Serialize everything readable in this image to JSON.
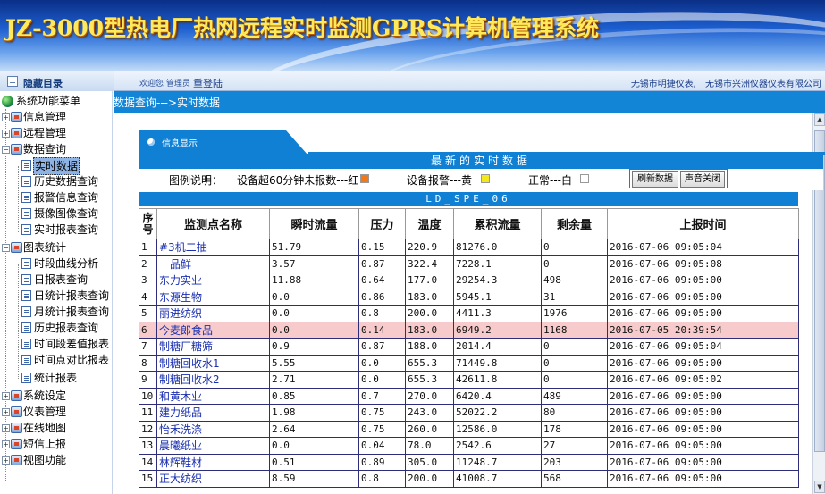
{
  "header": {
    "title": "JZ-3000型热电厂热网远程实时监测GPRS计算机管理系统"
  },
  "topbar": {
    "panel_title": "隐藏目录",
    "welcome": "欢迎您 管理员",
    "relogin": "重登陆",
    "company": "无锡市明捷仪表厂 无锡市兴洲仪器仪表有限公司"
  },
  "sidebar": {
    "root": "系统功能菜单",
    "items": [
      "信息管理",
      "远程管理",
      "数据查询",
      "实时数据",
      "历史数据查询",
      "报警信息查询",
      "摄像图像查询",
      "实时报表查询",
      "图表统计",
      "时段曲线分析",
      "日报表查询",
      "日统计报表查询",
      "月统计报表查询",
      "历史报表查询",
      "时间段差值报表",
      "时间点对比报表",
      "统计报表",
      "系统设定",
      "仪表管理",
      "在线地图",
      "短信上报",
      "视图功能"
    ]
  },
  "breadcrumb": "数据查询--->实时数据",
  "tab": {
    "label": "信息显示"
  },
  "heading": "最新的实时数据",
  "legend": {
    "label": "图例说明：",
    "red": "设备超60分钟未报数---红",
    "yellow": "设备报警---黄",
    "white": "正常---白",
    "btn_refresh": "刷新数据",
    "btn_sound": "声音关闭"
  },
  "colors": {
    "red": "#f07a1a",
    "yellow": "#f2e81c",
    "white": "#ffffff",
    "alert_row": "#f7cbcb",
    "accent": "#0f80d4"
  },
  "station": "LD_SPE_06",
  "table": {
    "headers": [
      "序号",
      "监测点名称",
      "瞬时流量",
      "压力",
      "温度",
      "累积流量",
      "剩余量",
      "上报时间"
    ],
    "rows": [
      [
        "1",
        "#3机二抽",
        "51.79",
        "0.15",
        "220.9",
        "81276.0",
        "0",
        "2016-07-06 09:05:04"
      ],
      [
        "2",
        "一品鲜",
        "3.57",
        "0.87",
        "322.4",
        "7228.1",
        "0",
        "2016-07-06 09:05:08"
      ],
      [
        "3",
        "东力实业",
        "11.88",
        "0.64",
        "177.0",
        "29254.3",
        "498",
        "2016-07-06 09:05:00"
      ],
      [
        "4",
        "东源生物",
        "0.0",
        "0.86",
        "183.0",
        "5945.1",
        "31",
        "2016-07-06 09:05:00"
      ],
      [
        "5",
        "丽进纺织",
        "0.0",
        "0.8",
        "200.0",
        "4411.3",
        "1976",
        "2016-07-06 09:05:00"
      ],
      [
        "6",
        "今麦郎食品",
        "0.0",
        "0.14",
        "183.0",
        "6949.2",
        "1168",
        "2016-07-05 20:39:54"
      ],
      [
        "7",
        "制糖厂糖筛",
        "0.9",
        "0.87",
        "188.0",
        "2014.4",
        "0",
        "2016-07-06 09:05:04"
      ],
      [
        "8",
        "制糖回收水1",
        "5.55",
        "0.0",
        "655.3",
        "71449.8",
        "0",
        "2016-07-06 09:05:00"
      ],
      [
        "9",
        "制糖回收水2",
        "2.71",
        "0.0",
        "655.3",
        "42611.8",
        "0",
        "2016-07-06 09:05:02"
      ],
      [
        "10",
        "和黄木业",
        "0.85",
        "0.7",
        "270.0",
        "6420.4",
        "489",
        "2016-07-06 09:05:00"
      ],
      [
        "11",
        "建力纸品",
        "1.98",
        "0.75",
        "243.0",
        "52022.2",
        "80",
        "2016-07-06 09:05:00"
      ],
      [
        "12",
        "怡禾洗涤",
        "2.64",
        "0.75",
        "260.0",
        "12586.0",
        "178",
        "2016-07-06 09:05:00"
      ],
      [
        "13",
        "晨曦纸业",
        "0.0",
        "0.04",
        "78.0",
        "2542.6",
        "27",
        "2016-07-06 09:05:00"
      ],
      [
        "14",
        "林辉鞋材",
        "0.51",
        "0.89",
        "305.0",
        "11248.7",
        "203",
        "2016-07-06 09:05:00"
      ],
      [
        "15",
        "正大纺织",
        "8.59",
        "0.8",
        "200.0",
        "41008.7",
        "568",
        "2016-07-06 09:05:00"
      ]
    ],
    "alert_rows": [
      6
    ]
  }
}
